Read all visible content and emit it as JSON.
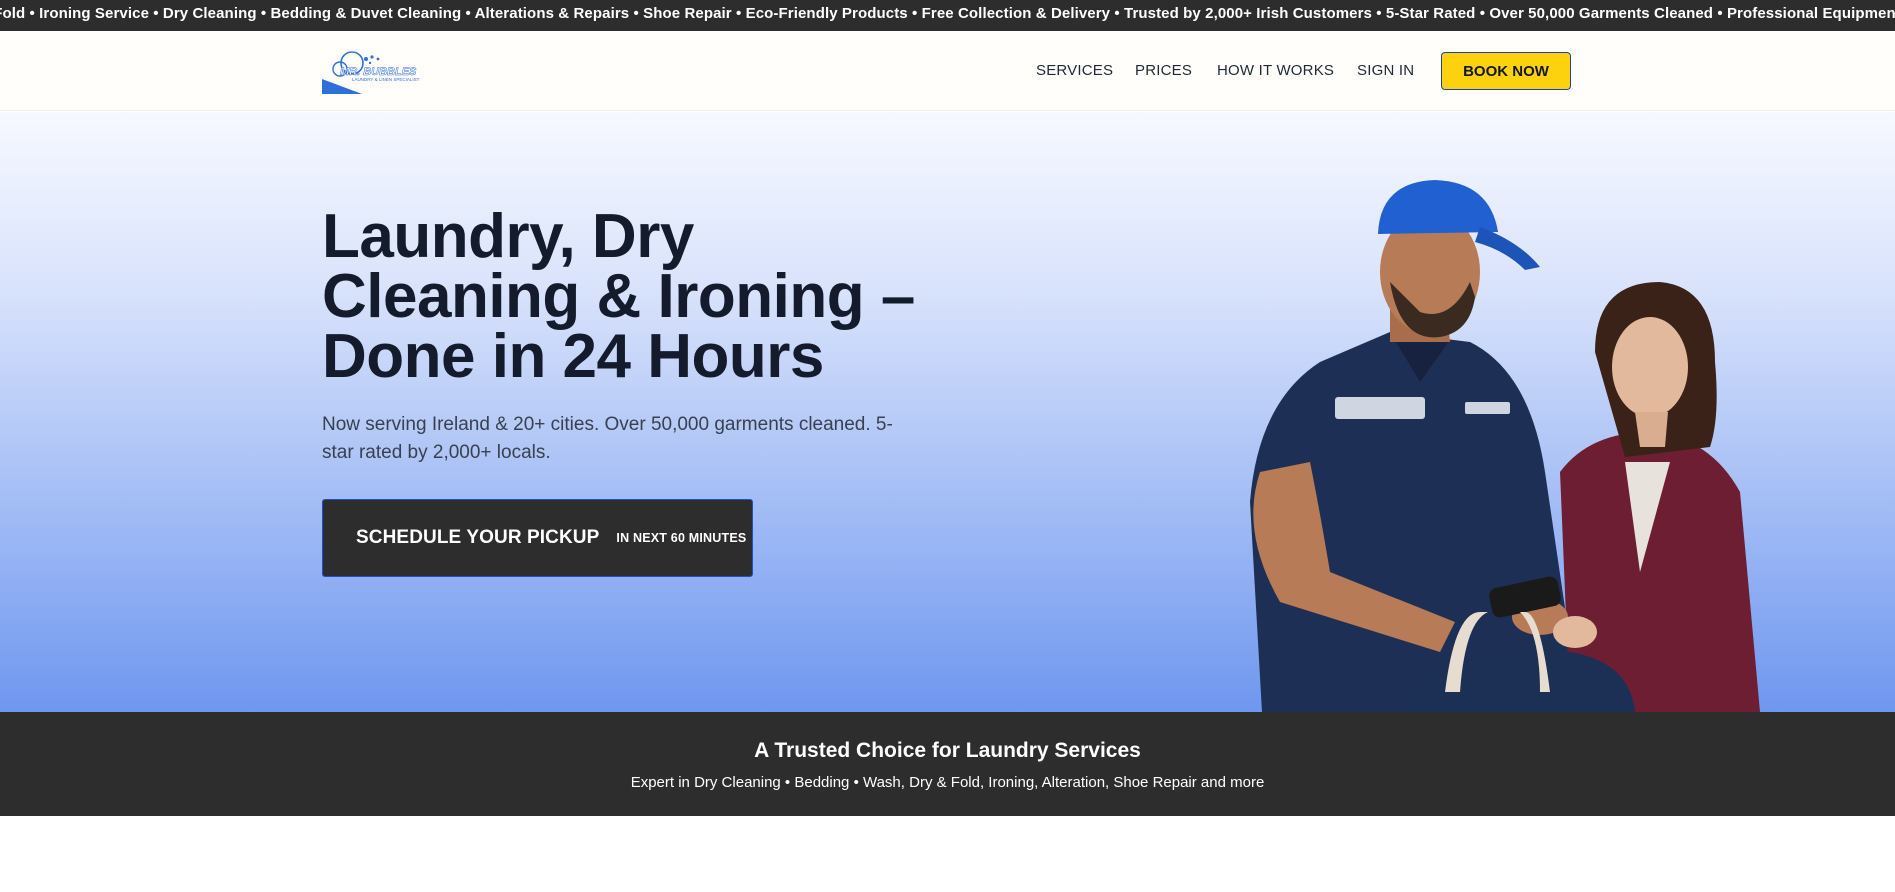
{
  "ticker": {
    "text": "& Fold • Ironing Service • Dry Cleaning • Bedding & Duvet Cleaning • Alterations & Repairs • Shoe Repair • Eco-Friendly Products • Free Collection & Delivery • Trusted by 2,000+ Irish Customers • 5-Star Rated • Over 50,000 Garments Cleaned • Professional Equipment • Expert Care •"
  },
  "header": {
    "logo_text": "MR. BUBBLES",
    "logo_tagline": "LAUNDRY & LINEN SPECIALIST",
    "nav": {
      "services": "SERVICES",
      "prices": "PRICES",
      "how_it_works": "HOW IT WORKS",
      "sign_in": "SIGN IN"
    },
    "book_now": "BOOK NOW"
  },
  "hero": {
    "title": "Laundry, Dry Cleaning & Ironing – Done in 24 Hours",
    "subtitle": "Now serving Ireland & 20+ cities. Over 50,000 garments cleaned. 5-star rated by 2,000+ locals.",
    "cta_main": "SCHEDULE YOUR PICKUP",
    "cta_sub": "IN NEXT 60 MINUTES"
  },
  "trust": {
    "title": "A Trusted Choice for Laundry Services",
    "subtitle": "Expert in Dry Cleaning • Bedding • Wash, Dry & Fold, Ironing, Alteration, Shoe Repair and more"
  },
  "colors": {
    "dark": "#2d2d2d",
    "accent_yellow": "#fcd20f",
    "brand_blue": "#2f6fd8"
  }
}
